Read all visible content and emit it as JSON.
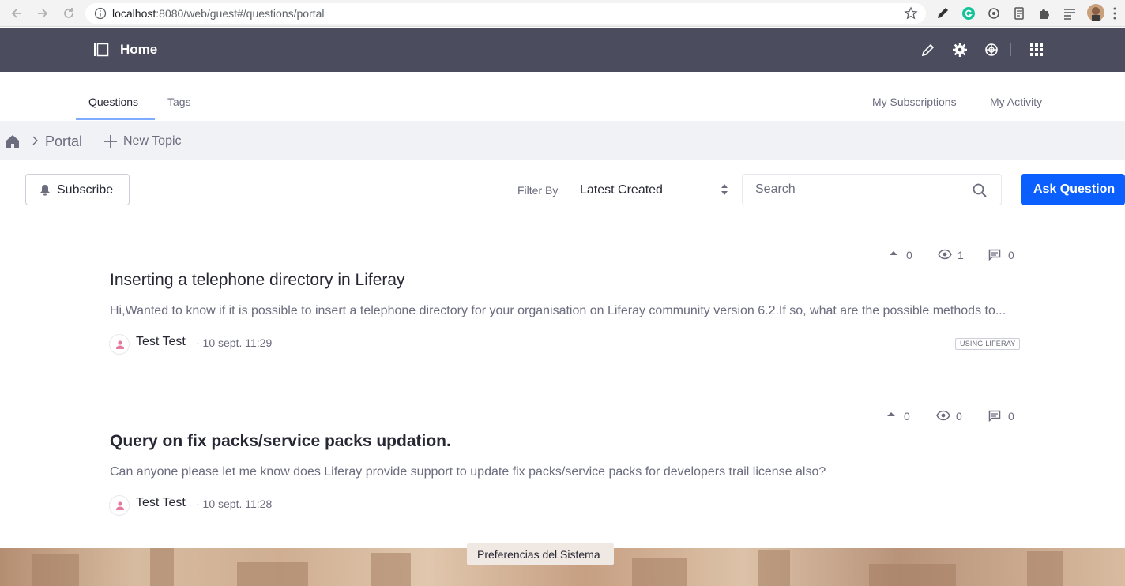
{
  "browser": {
    "url_host": "localhost",
    "url_rest": ":8080/web/guest#/questions/portal"
  },
  "control_bar": {
    "title": "Home"
  },
  "tabs": [
    {
      "label": "Questions",
      "active": true
    },
    {
      "label": "Tags",
      "active": false
    }
  ],
  "nav_right": {
    "subscriptions": "My Subscriptions",
    "activity": "My Activity"
  },
  "breadcrumb": {
    "current": "Portal",
    "new_topic": "New Topic"
  },
  "toolbar": {
    "subscribe": "Subscribe",
    "filter_label": "Filter By",
    "filter_value": "Latest Created",
    "search_placeholder": "Search",
    "ask": "Ask Question"
  },
  "questions": [
    {
      "votes": "0",
      "views": "1",
      "answers": "0",
      "title": "Inserting a telephone directory in Liferay",
      "body": "Hi,Wanted to know if it is possible to insert a telephone directory for your organisation on Liferay community version 6.2.If so, what are the possible methods to...",
      "author": "Test Test",
      "date": "- 10 sept. 11:29",
      "tag": "USING LIFERAY"
    },
    {
      "votes": "0",
      "views": "0",
      "answers": "0",
      "title": "Query on fix packs/service packs updation.",
      "body": "Can anyone please let me know does Liferay provide support to update fix packs/service packs  for developers trail license also?",
      "author": "Test Test",
      "date": "- 10 sept. 11:28",
      "tag": ""
    }
  ],
  "footer": {
    "tooltip": "Preferencias del Sistema"
  },
  "colors": {
    "control_bar": "#4b4c5d",
    "primary": "#0b5fff",
    "tab_underline": "#80acff",
    "muted_text": "#6b6c7e"
  }
}
